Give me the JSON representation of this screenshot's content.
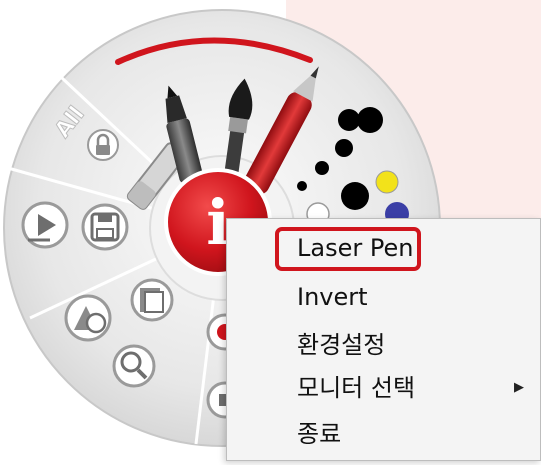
{
  "menu": {
    "items": [
      {
        "label": "Laser Pen",
        "highlighted": true
      },
      {
        "label": "Invert"
      },
      {
        "label": "환경설정"
      },
      {
        "label": "모니터 선택",
        "has_submenu": true,
        "arrow": "▶"
      },
      {
        "label": "종료"
      }
    ],
    "highlight_color": "#d0151d"
  },
  "wheel": {
    "center_letter": "i",
    "all_label": "All",
    "accent_color": "#d0151d",
    "pen_colors": [
      "#000000",
      "#000000",
      "#000000",
      "#000000",
      "#000000",
      "#000000",
      "#f2e21a",
      "#ffffff",
      "#3b3fa6"
    ],
    "icons": [
      "lock-icon",
      "play-screen-icon",
      "save-icon",
      "shapes-icon",
      "open-folder-icon",
      "zoom-icon",
      "record-icon",
      "stop-icon",
      "highlighter-icon",
      "brush-icon",
      "pen-icon",
      "eraser-icon"
    ]
  },
  "colors": {
    "background_panel": "#fcecea",
    "wheel_ring": "#e6e6e6"
  }
}
